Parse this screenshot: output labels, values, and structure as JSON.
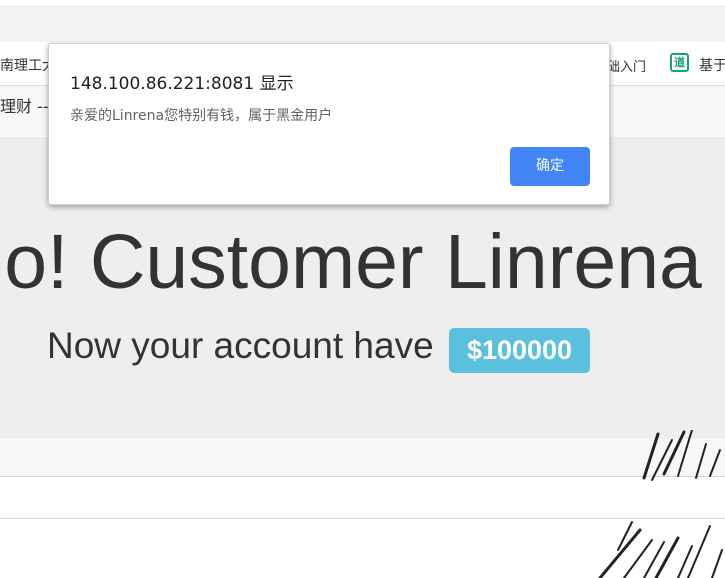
{
  "browser": {
    "bookmarks": {
      "left_item": "南理工大",
      "right_item_1": "础入门",
      "right_item_2_icon": "道",
      "right_item_2": "基于"
    }
  },
  "page": {
    "nav_brand": "理财 --",
    "hero_title": "llo! Customer Linrena",
    "account_text": "Now your account have",
    "balance": "$100000",
    "colors": {
      "jumbotron_bg": "#eeeeee",
      "badge_bg": "#5bc0de",
      "button_bg": "#4285f4"
    }
  },
  "dialog": {
    "origin": "148.100.86.221:8081 显示",
    "message": "亲爱的Linrena您特别有钱，属于黑金用户",
    "ok_label": "确定"
  }
}
